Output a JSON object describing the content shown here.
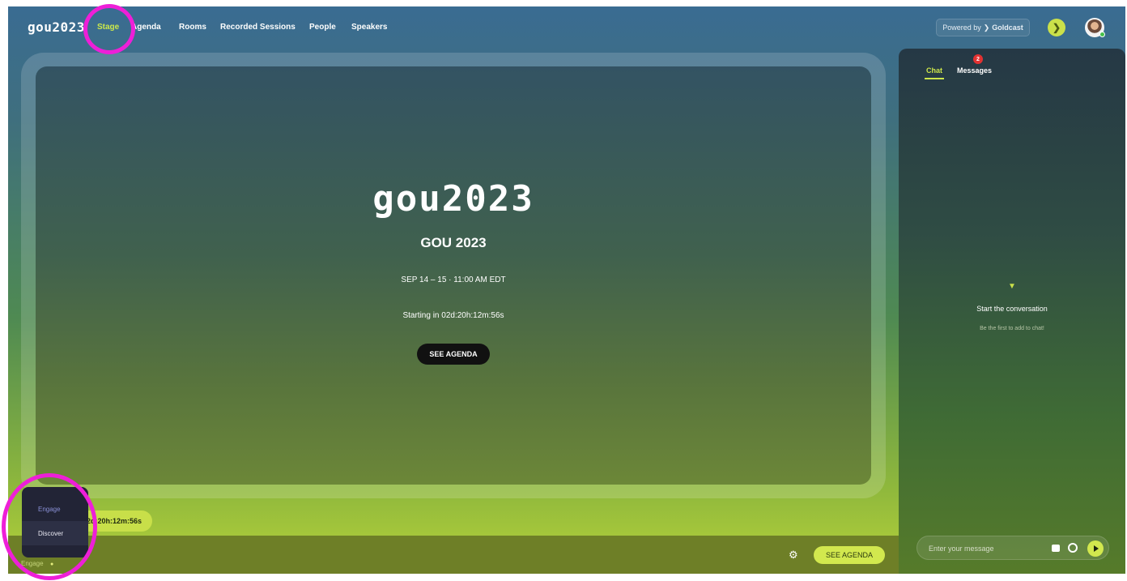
{
  "nav": {
    "logo": "gou2023",
    "items": [
      "Stage",
      "Agenda",
      "Rooms",
      "Recorded Sessions",
      "People",
      "Speakers"
    ],
    "powered_by_prefix": "Powered by",
    "powered_by_brand": "Goldcast"
  },
  "stage": {
    "logo": "gou2023",
    "title": "GOU 2023",
    "date": "SEP 14 – 15 · 11:00 AM EDT",
    "countdown": "Starting in 02d:20h:12m:56s",
    "agenda_button": "SEE AGENDA"
  },
  "countdown_pill": "2d:20h:12m:56s",
  "bottom_bar": {
    "engage_label": "Engage",
    "settings_icon": "gear-icon",
    "agenda_button": "SEE AGENDA"
  },
  "popup_menu": {
    "items": [
      "Engage",
      "Discover"
    ],
    "active": "Engage"
  },
  "chat": {
    "tabs": [
      "Chat",
      "Messages"
    ],
    "active_tab": "Chat",
    "messages_badge": "2",
    "empty_title": "Start the conversation",
    "empty_subtitle": "Be the first to add to chat!",
    "input_placeholder": "Enter your message"
  },
  "colors": {
    "accent": "#cde64b",
    "annotation": "#ee1fd8",
    "badge": "#e23232"
  }
}
